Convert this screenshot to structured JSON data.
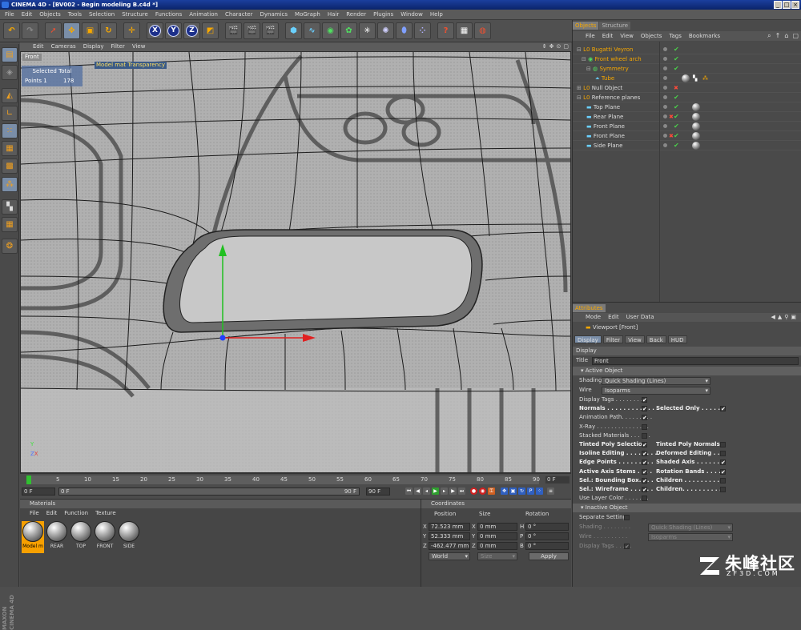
{
  "window": {
    "app": "CINEMA 4D",
    "title": "CINEMA 4D - [BV002 - Begin modeling B.c4d *]",
    "btn_min": "_",
    "btn_max": "□",
    "btn_close": "×"
  },
  "menu": [
    "File",
    "Edit",
    "Objects",
    "Tools",
    "Selection",
    "Structure",
    "Functions",
    "Animation",
    "Character",
    "Dynamics",
    "MoGraph",
    "Hair",
    "Render",
    "Plugins",
    "Window",
    "Help"
  ],
  "toolbar": {
    "x_label": "X",
    "y_label": "Y",
    "z_label": "Z"
  },
  "viewport": {
    "menu": [
      "Edit",
      "Cameras",
      "Display",
      "Filter",
      "View"
    ],
    "name": "Front",
    "hud": {
      "selected_total": "Selected Total",
      "points_label": "Points",
      "points_selected": "1",
      "points_total": "178"
    },
    "material_label": "Model mat Transparency",
    "axis_y": "Y",
    "axis_z": "Z",
    "axis_x": "X",
    "nav": [
      "⇕",
      "✥",
      "⊙",
      "▢"
    ]
  },
  "timeline": {
    "ticks": [
      "0",
      "5",
      "10",
      "15",
      "20",
      "25",
      "30",
      "35",
      "40",
      "45",
      "50",
      "55",
      "60",
      "65",
      "70",
      "75",
      "80",
      "85",
      "90"
    ],
    "current_frame": "0 F",
    "start_field": "0 F",
    "range_start": "0 F",
    "range_end": "90 F",
    "end_field": "90 F"
  },
  "materials": {
    "title": "Materials",
    "menu": [
      "File",
      "Edit",
      "Function",
      "Texture"
    ],
    "items": [
      "Model m",
      "REAR",
      "TOP",
      "FRONT",
      "SIDE"
    ]
  },
  "coordinates": {
    "title": "Coordinates",
    "col_position": "Position",
    "col_size": "Size",
    "col_rotation": "Rotation",
    "rows": [
      {
        "axis": "X",
        "pos": "72.523 mm",
        "saxis": "X",
        "size": "0 mm",
        "raxis": "H",
        "rot": "0 °"
      },
      {
        "axis": "Y",
        "pos": "52.333 mm",
        "saxis": "Y",
        "size": "0 mm",
        "raxis": "P",
        "rot": "0 °"
      },
      {
        "axis": "Z",
        "pos": "-462.477 mm",
        "saxis": "Z",
        "size": "0 mm",
        "raxis": "B",
        "rot": "0 °"
      }
    ],
    "mode": "World",
    "size_mode": "Size",
    "apply": "Apply"
  },
  "objects": {
    "tabs": [
      "Objects",
      "Structure"
    ],
    "menu": [
      "File",
      "Edit",
      "View",
      "Objects",
      "Tags",
      "Bookmarks"
    ],
    "tree": [
      {
        "name": "Bugatti Veyron",
        "indent": 0,
        "color": "#f7a800"
      },
      {
        "name": "Front wheel arch",
        "indent": 1,
        "color": "#f7a800"
      },
      {
        "name": "Symmetry",
        "indent": 2,
        "color": "#f7a800"
      },
      {
        "name": "Tube",
        "indent": 3,
        "color": "#f7a800"
      },
      {
        "name": "Null Object",
        "indent": 0,
        "color": "#dcdcdc"
      },
      {
        "name": "Reference planes",
        "indent": 0,
        "color": "#dcdcdc"
      },
      {
        "name": "Top Plane",
        "indent": 1,
        "color": "#dcdcdc"
      },
      {
        "name": "Rear Plane",
        "indent": 1,
        "color": "#dcdcdc"
      },
      {
        "name": "Front Plane",
        "indent": 1,
        "color": "#dcdcdc"
      },
      {
        "name": "Front Plane",
        "indent": 1,
        "color": "#dcdcdc"
      },
      {
        "name": "Side Plane",
        "indent": 1,
        "color": "#dcdcdc"
      }
    ]
  },
  "attributes": {
    "title": "Attributes",
    "menu": [
      "Mode",
      "Edit",
      "User Data"
    ],
    "object_title": "Viewport [Front]",
    "tabs": [
      "Display",
      "Filter",
      "View",
      "Back",
      "HUD"
    ],
    "section": "Display",
    "title_label": "Title",
    "title_value": "Front",
    "active_object": "Active Object",
    "shading_label": "Shading",
    "shading_value": "Quick Shading (Lines)",
    "wire_label": "Wire",
    "wire_value": "Isoparms",
    "checks": [
      {
        "label": "Display Tags . . . . . . . . .",
        "checked": true,
        "bold": false
      },
      {
        "label": "Normals . . . . . . . . . . . . .",
        "checked": true,
        "bold": true
      },
      {
        "label": "Animation Path. . . . . . . . .",
        "checked": true,
        "bold": false
      },
      {
        "label": "X-Ray . . . . . . . . . . . . . . .",
        "checked": false,
        "bold": false
      },
      {
        "label": "Stacked Materials . . . . . .",
        "checked": false,
        "bold": false
      },
      {
        "label": "Tinted Poly Selection",
        "checked": true,
        "bold": true
      },
      {
        "label": "Isoline Editing . . . . . . . .",
        "checked": true,
        "bold": true
      },
      {
        "label": "Edge Points . . . . . . . . .",
        "checked": true,
        "bold": true
      },
      {
        "label": "Active Axis Stems . . . .",
        "checked": true,
        "bold": true
      },
      {
        "label": "Sel.: Bounding Box. . . .",
        "checked": true,
        "bold": true
      },
      {
        "label": "Sel.: Wireframe . . . . . .",
        "checked": true,
        "bold": true
      },
      {
        "label": "Use Layer Color . . . . . . .",
        "checked": false,
        "bold": false
      }
    ],
    "checks_right": [
      {
        "label": "Selected Only . . . . .",
        "checked": true,
        "row": 1
      },
      {
        "label": "Tinted Poly Normals",
        "checked": false,
        "row": 5
      },
      {
        "label": "Deformed Editing . .",
        "checked": false,
        "row": 6
      },
      {
        "label": "Shaded Axis . . . . . . .",
        "checked": true,
        "row": 7
      },
      {
        "label": "Rotation Bands . . . . .",
        "checked": true,
        "row": 8
      },
      {
        "label": "Children . . . . . . . . . .",
        "checked": false,
        "row": 9
      },
      {
        "label": "Children. . . . . . . . . .",
        "checked": false,
        "row": 10
      }
    ],
    "inactive_object": "Inactive Object",
    "separate_settings": "Separate Settings",
    "inactive_shading_label": "Shading . . . . . . . .",
    "inactive_shading_value": "Quick Shading (Lines)",
    "inactive_wire_label": "Wire . . . . . . . . . .",
    "inactive_wire_value": "Isoparms",
    "inactive_tags": "Display Tags . . . . ."
  },
  "watermark": {
    "text": "朱峰社区",
    "sub": "ZF3D.COM"
  }
}
